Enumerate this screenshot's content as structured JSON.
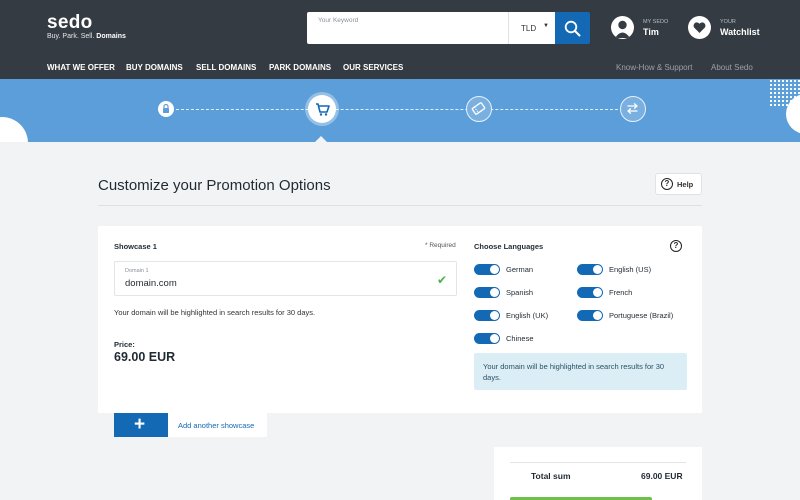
{
  "brand": {
    "name": "sedo",
    "tagline_prefix": "Buy. Park. Sell.",
    "tagline_bold": "Domains"
  },
  "search": {
    "placeholder": "Your Keyword",
    "tld": "TLD"
  },
  "user": {
    "small_label": "MY SEDO",
    "name": "Tim"
  },
  "watchlist": {
    "small_label": "YOUR",
    "label": "Watchlist"
  },
  "nav": {
    "items": [
      "WHAT WE OFFER",
      "BUY DOMAINS",
      "SELL DOMAINS",
      "PARK DOMAINS",
      "OUR SERVICES"
    ],
    "right": [
      "Know-How & Support",
      "About Sedo"
    ]
  },
  "stepper": {
    "steps": [
      "lock-icon",
      "cart-icon",
      "ticket-icon",
      "transfer-icon"
    ],
    "active_index": 1
  },
  "page": {
    "title": "Customize your Promotion Options",
    "help_label": "Help"
  },
  "showcase": {
    "title": "Showcase 1",
    "required": "* Required",
    "field_label": "Domain 1",
    "field_value": "domain.com",
    "description": "Your domain will be highlighted in search results for 30 days.",
    "price_label": "Price:",
    "price_value": "69.00 EUR"
  },
  "languages": {
    "title": "Choose Languages",
    "items": [
      {
        "label": "German",
        "on": true
      },
      {
        "label": "English (US)",
        "on": true
      },
      {
        "label": "Spanish",
        "on": true
      },
      {
        "label": "French",
        "on": true
      },
      {
        "label": "English (UK)",
        "on": true
      },
      {
        "label": "Portuguese (Brazil)",
        "on": true
      },
      {
        "label": "Chinese",
        "on": true
      }
    ],
    "info": "Your domain will be highlighted in search results for 30 days."
  },
  "add_showcase": {
    "plus": "+",
    "label": "Add another showcase"
  },
  "total": {
    "label": "Total sum",
    "value": "69.00 EUR"
  },
  "colors": {
    "header": "#353b42",
    "primary": "#1469b5",
    "band": "#5b9ed9",
    "success": "#4cb24a"
  }
}
